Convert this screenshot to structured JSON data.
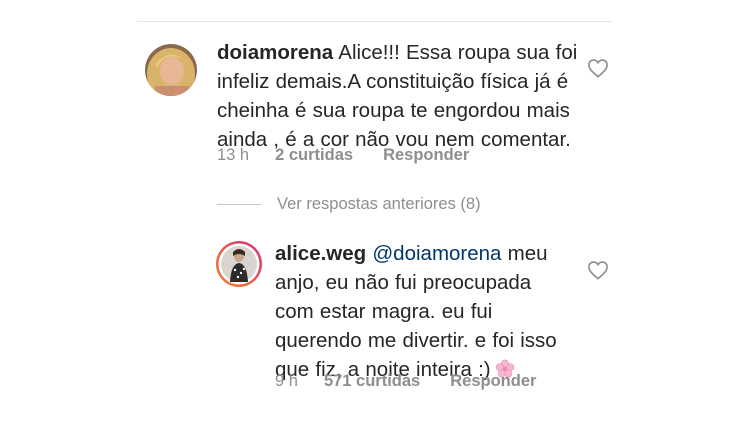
{
  "comment": {
    "username": "doiamorena",
    "text": "Alice!!! Essa roupa sua foi infeliz demais.A constituição  física já é cheinha é sua roupa te engordou mais ainda , é a cor não vou nem comentar.",
    "time": "13 h",
    "likes": "2 curtidas",
    "reply_label": "Responder",
    "avatar_icon": "profile-photo-blonde-woman"
  },
  "view_replies": {
    "label": "Ver respostas anteriores (8)"
  },
  "reply": {
    "username": "alice.weg",
    "mention": "@doiamorena",
    "text": "meu anjo, eu não fui preocupada com estar magra. eu fui querendo me divertir. e foi isso que fiz, a noite inteira :)",
    "emoji": "cherry-blossom-emoji",
    "time": "9 h",
    "likes": "571 curtidas",
    "reply_label": "Responder",
    "avatar_icon": "profile-photo-story-ring"
  },
  "icons": {
    "like": "heart-outline-icon"
  },
  "colors": {
    "text": "#262626",
    "secondary": "#8e8e8e",
    "mention": "#00376b",
    "story_ring_start": "#f58529",
    "story_ring_end": "#dd2a7b"
  }
}
